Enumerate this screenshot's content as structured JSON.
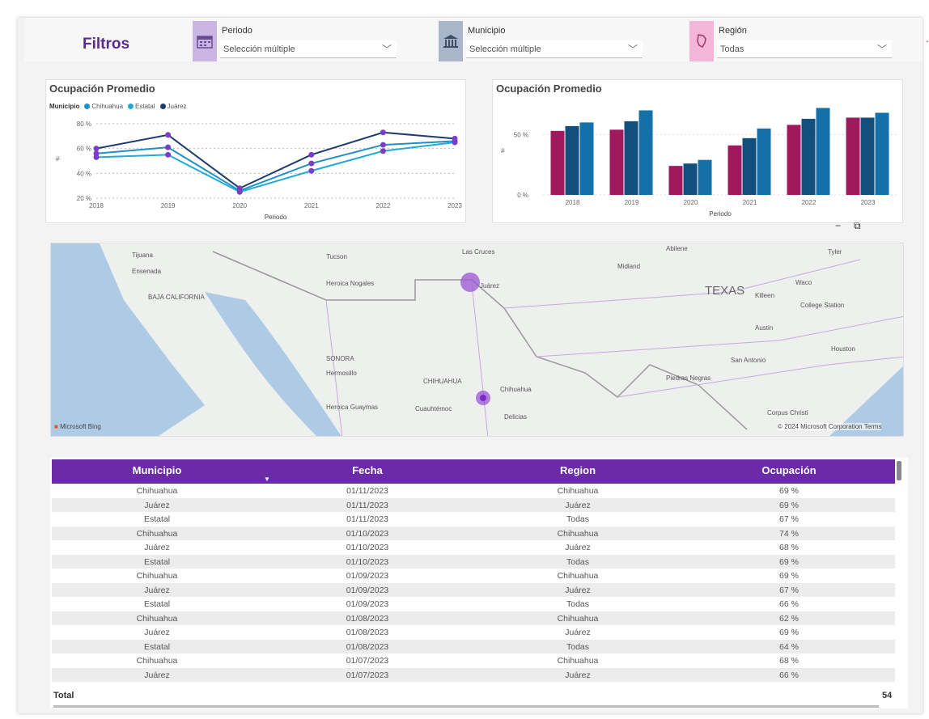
{
  "header": {
    "title": "Filtros",
    "filters": [
      {
        "label": "Periodo",
        "value": "Selección múltiple",
        "icon": "calendar-icon",
        "color": "#c9b6e4"
      },
      {
        "label": "Municipio",
        "value": "Selección múltiple",
        "icon": "building-icon",
        "color": "#a9b6c9"
      },
      {
        "label": "Región",
        "value": "Todas",
        "icon": "map-region-icon",
        "color": "#f3b6d6"
      }
    ]
  },
  "line_chart": {
    "title": "Ocupación Promedio",
    "legend_title": "Municipio"
  },
  "bar_chart": {
    "title": "Ocupación Promedio"
  },
  "chart_data": [
    {
      "type": "line",
      "title": "Ocupación Promedio",
      "xlabel": "Periodo",
      "ylabel": "#",
      "x": [
        "2018",
        "2019",
        "2020",
        "2021",
        "2022",
        "2023"
      ],
      "yticks": [
        "20 %",
        "40 %",
        "60 %",
        "80 %"
      ],
      "ylim": [
        20,
        80
      ],
      "series": [
        {
          "name": "Chihuahua",
          "color": "#1f8fc4",
          "values": [
            56,
            61,
            26,
            48,
            63,
            66
          ]
        },
        {
          "name": "Estatal",
          "color": "#22a9d6",
          "values": [
            53,
            55,
            25,
            42,
            58,
            65
          ]
        },
        {
          "name": "Juárez",
          "color": "#1e3a6e",
          "values": [
            60,
            71,
            28,
            55,
            73,
            68
          ]
        }
      ],
      "grid": true,
      "legend": "top-left"
    },
    {
      "type": "bar",
      "title": "Ocupación Promedio",
      "xlabel": "Periodo",
      "ylabel": "#",
      "categories": [
        "2018",
        "2019",
        "2020",
        "2021",
        "2022",
        "2023"
      ],
      "yticks": [
        "0 %",
        "50 %"
      ],
      "ylim": [
        0,
        75
      ],
      "series": [
        {
          "color": "#a0185e",
          "values": [
            53,
            54,
            24,
            41,
            58,
            64
          ]
        },
        {
          "color": "#124f7c",
          "values": [
            57,
            61,
            26,
            47,
            63,
            64
          ]
        },
        {
          "color": "#1470a8",
          "values": [
            60,
            70,
            29,
            55,
            72,
            68
          ]
        }
      ]
    }
  ],
  "map": {
    "labels": [
      "Tijuana",
      "Ensenada",
      "BAJA CALIFORNIA",
      "Tucson",
      "Heroica Nogales",
      "Las Cruces",
      "Juárez",
      "Midland",
      "Abilene",
      "Tyler",
      "TEXAS",
      "Waco",
      "Killeen",
      "College Station",
      "Austin",
      "San Antonio",
      "Houston",
      "SONORA",
      "Hermosillo",
      "CHIHUAHUA",
      "Chihuahua",
      "Cuauhtémoc",
      "Delicias",
      "Heroica Guaymas",
      "Piedras Negras",
      "Corpus Christi"
    ],
    "attribution": "© 2024 Microsoft Corporation  Terms",
    "logo": "Microsoft Bing"
  },
  "table": {
    "headers": [
      "Municipio",
      "Fecha",
      "Region",
      "Ocupación"
    ],
    "rows": [
      [
        "Chihuahua",
        "01/11/2023",
        "Chihuahua",
        "69 %"
      ],
      [
        "Juárez",
        "01/11/2023",
        "Juárez",
        "69 %"
      ],
      [
        "Estatal",
        "01/11/2023",
        "Todas",
        "67 %"
      ],
      [
        "Chihuahua",
        "01/10/2023",
        "Chihuahua",
        "74 %"
      ],
      [
        "Juárez",
        "01/10/2023",
        "Juárez",
        "68 %"
      ],
      [
        "Estatal",
        "01/10/2023",
        "Todas",
        "69 %"
      ],
      [
        "Chihuahua",
        "01/09/2023",
        "Chihuahua",
        "69 %"
      ],
      [
        "Juárez",
        "01/09/2023",
        "Juárez",
        "67 %"
      ],
      [
        "Estatal",
        "01/09/2023",
        "Todas",
        "66 %"
      ],
      [
        "Chihuahua",
        "01/08/2023",
        "Chihuahua",
        "62 %"
      ],
      [
        "Juárez",
        "01/08/2023",
        "Juárez",
        "69 %"
      ],
      [
        "Estatal",
        "01/08/2023",
        "Todas",
        "64 %"
      ],
      [
        "Chihuahua",
        "01/07/2023",
        "Chihuahua",
        "68 %"
      ],
      [
        "Juárez",
        "01/07/2023",
        "Juárez",
        "66 %"
      ]
    ],
    "total_label": "Total",
    "total_value": "54"
  },
  "map_tools": {
    "minus": "−",
    "focus": "⧉"
  }
}
